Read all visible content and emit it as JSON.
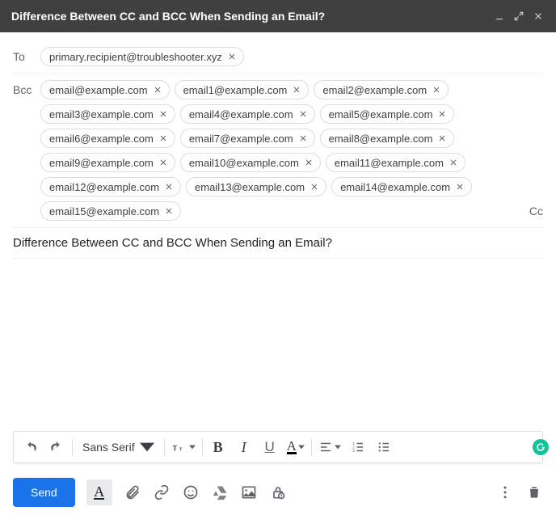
{
  "header": {
    "title": "Difference Between CC and BCC When Sending an Email?"
  },
  "to": {
    "label": "To",
    "recipients": [
      "primary.recipient@troubleshooter.xyz"
    ]
  },
  "bcc": {
    "label": "Bcc",
    "recipients": [
      "email@example.com",
      "email1@example.com",
      "email2@example.com",
      "email3@example.com",
      "email4@example.com",
      "email5@example.com",
      "email6@example.com",
      "email7@example.com",
      "email8@example.com",
      "email9@example.com",
      "email10@example.com",
      "email11@example.com",
      "email12@example.com",
      "email13@example.com",
      "email14@example.com",
      "email15@example.com"
    ],
    "cc_toggle": "Cc"
  },
  "subject": "Difference Between CC and BCC When Sending an Email?",
  "formatting": {
    "font_label": "Sans Serif"
  },
  "send_label": "Send"
}
